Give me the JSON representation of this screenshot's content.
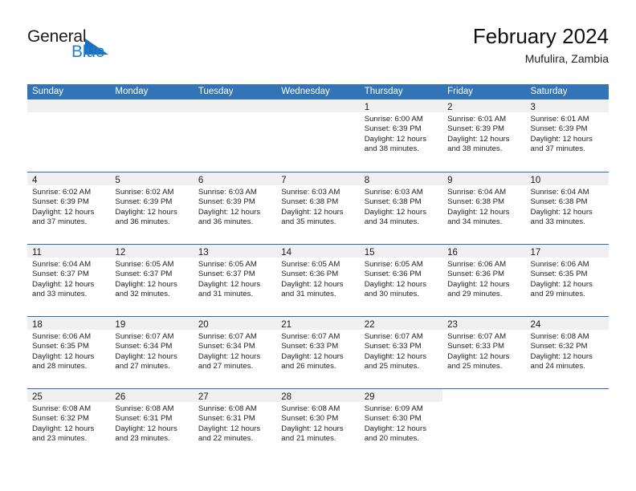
{
  "brand": {
    "word_general": "General",
    "word_blue": "Blue",
    "flag_icon": "triangle-flag-icon",
    "accent_color": "#1f7fd0"
  },
  "header": {
    "title": "February 2024",
    "subtitle": "Mufulira, Zambia"
  },
  "theme": {
    "header_blue": "#3274b5",
    "row_divider": "#2a6cb0",
    "daynum_band": "#f0f0f0"
  },
  "calendar": {
    "weekdays": [
      "Sunday",
      "Monday",
      "Tuesday",
      "Wednesday",
      "Thursday",
      "Friday",
      "Saturday"
    ],
    "weeks": [
      [
        {
          "day": "",
          "blank": true
        },
        {
          "day": "",
          "blank": true
        },
        {
          "day": "",
          "blank": true
        },
        {
          "day": "",
          "blank": true
        },
        {
          "day": "1",
          "sunrise": "Sunrise: 6:00 AM",
          "sunset": "Sunset: 6:39 PM",
          "daylight_line1": "Daylight: 12 hours",
          "daylight_line2": "and 38 minutes."
        },
        {
          "day": "2",
          "sunrise": "Sunrise: 6:01 AM",
          "sunset": "Sunset: 6:39 PM",
          "daylight_line1": "Daylight: 12 hours",
          "daylight_line2": "and 38 minutes."
        },
        {
          "day": "3",
          "sunrise": "Sunrise: 6:01 AM",
          "sunset": "Sunset: 6:39 PM",
          "daylight_line1": "Daylight: 12 hours",
          "daylight_line2": "and 37 minutes."
        }
      ],
      [
        {
          "day": "4",
          "sunrise": "Sunrise: 6:02 AM",
          "sunset": "Sunset: 6:39 PM",
          "daylight_line1": "Daylight: 12 hours",
          "daylight_line2": "and 37 minutes."
        },
        {
          "day": "5",
          "sunrise": "Sunrise: 6:02 AM",
          "sunset": "Sunset: 6:39 PM",
          "daylight_line1": "Daylight: 12 hours",
          "daylight_line2": "and 36 minutes."
        },
        {
          "day": "6",
          "sunrise": "Sunrise: 6:03 AM",
          "sunset": "Sunset: 6:39 PM",
          "daylight_line1": "Daylight: 12 hours",
          "daylight_line2": "and 36 minutes."
        },
        {
          "day": "7",
          "sunrise": "Sunrise: 6:03 AM",
          "sunset": "Sunset: 6:38 PM",
          "daylight_line1": "Daylight: 12 hours",
          "daylight_line2": "and 35 minutes."
        },
        {
          "day": "8",
          "sunrise": "Sunrise: 6:03 AM",
          "sunset": "Sunset: 6:38 PM",
          "daylight_line1": "Daylight: 12 hours",
          "daylight_line2": "and 34 minutes."
        },
        {
          "day": "9",
          "sunrise": "Sunrise: 6:04 AM",
          "sunset": "Sunset: 6:38 PM",
          "daylight_line1": "Daylight: 12 hours",
          "daylight_line2": "and 34 minutes."
        },
        {
          "day": "10",
          "sunrise": "Sunrise: 6:04 AM",
          "sunset": "Sunset: 6:38 PM",
          "daylight_line1": "Daylight: 12 hours",
          "daylight_line2": "and 33 minutes."
        }
      ],
      [
        {
          "day": "11",
          "sunrise": "Sunrise: 6:04 AM",
          "sunset": "Sunset: 6:37 PM",
          "daylight_line1": "Daylight: 12 hours",
          "daylight_line2": "and 33 minutes."
        },
        {
          "day": "12",
          "sunrise": "Sunrise: 6:05 AM",
          "sunset": "Sunset: 6:37 PM",
          "daylight_line1": "Daylight: 12 hours",
          "daylight_line2": "and 32 minutes."
        },
        {
          "day": "13",
          "sunrise": "Sunrise: 6:05 AM",
          "sunset": "Sunset: 6:37 PM",
          "daylight_line1": "Daylight: 12 hours",
          "daylight_line2": "and 31 minutes."
        },
        {
          "day": "14",
          "sunrise": "Sunrise: 6:05 AM",
          "sunset": "Sunset: 6:36 PM",
          "daylight_line1": "Daylight: 12 hours",
          "daylight_line2": "and 31 minutes."
        },
        {
          "day": "15",
          "sunrise": "Sunrise: 6:05 AM",
          "sunset": "Sunset: 6:36 PM",
          "daylight_line1": "Daylight: 12 hours",
          "daylight_line2": "and 30 minutes."
        },
        {
          "day": "16",
          "sunrise": "Sunrise: 6:06 AM",
          "sunset": "Sunset: 6:36 PM",
          "daylight_line1": "Daylight: 12 hours",
          "daylight_line2": "and 29 minutes."
        },
        {
          "day": "17",
          "sunrise": "Sunrise: 6:06 AM",
          "sunset": "Sunset: 6:35 PM",
          "daylight_line1": "Daylight: 12 hours",
          "daylight_line2": "and 29 minutes."
        }
      ],
      [
        {
          "day": "18",
          "sunrise": "Sunrise: 6:06 AM",
          "sunset": "Sunset: 6:35 PM",
          "daylight_line1": "Daylight: 12 hours",
          "daylight_line2": "and 28 minutes."
        },
        {
          "day": "19",
          "sunrise": "Sunrise: 6:07 AM",
          "sunset": "Sunset: 6:34 PM",
          "daylight_line1": "Daylight: 12 hours",
          "daylight_line2": "and 27 minutes."
        },
        {
          "day": "20",
          "sunrise": "Sunrise: 6:07 AM",
          "sunset": "Sunset: 6:34 PM",
          "daylight_line1": "Daylight: 12 hours",
          "daylight_line2": "and 27 minutes."
        },
        {
          "day": "21",
          "sunrise": "Sunrise: 6:07 AM",
          "sunset": "Sunset: 6:33 PM",
          "daylight_line1": "Daylight: 12 hours",
          "daylight_line2": "and 26 minutes."
        },
        {
          "day": "22",
          "sunrise": "Sunrise: 6:07 AM",
          "sunset": "Sunset: 6:33 PM",
          "daylight_line1": "Daylight: 12 hours",
          "daylight_line2": "and 25 minutes."
        },
        {
          "day": "23",
          "sunrise": "Sunrise: 6:07 AM",
          "sunset": "Sunset: 6:33 PM",
          "daylight_line1": "Daylight: 12 hours",
          "daylight_line2": "and 25 minutes."
        },
        {
          "day": "24",
          "sunrise": "Sunrise: 6:08 AM",
          "sunset": "Sunset: 6:32 PM",
          "daylight_line1": "Daylight: 12 hours",
          "daylight_line2": "and 24 minutes."
        }
      ],
      [
        {
          "day": "25",
          "sunrise": "Sunrise: 6:08 AM",
          "sunset": "Sunset: 6:32 PM",
          "daylight_line1": "Daylight: 12 hours",
          "daylight_line2": "and 23 minutes."
        },
        {
          "day": "26",
          "sunrise": "Sunrise: 6:08 AM",
          "sunset": "Sunset: 6:31 PM",
          "daylight_line1": "Daylight: 12 hours",
          "daylight_line2": "and 23 minutes."
        },
        {
          "day": "27",
          "sunrise": "Sunrise: 6:08 AM",
          "sunset": "Sunset: 6:31 PM",
          "daylight_line1": "Daylight: 12 hours",
          "daylight_line2": "and 22 minutes."
        },
        {
          "day": "28",
          "sunrise": "Sunrise: 6:08 AM",
          "sunset": "Sunset: 6:30 PM",
          "daylight_line1": "Daylight: 12 hours",
          "daylight_line2": "and 21 minutes."
        },
        {
          "day": "29",
          "sunrise": "Sunrise: 6:09 AM",
          "sunset": "Sunset: 6:30 PM",
          "daylight_line1": "Daylight: 12 hours",
          "daylight_line2": "and 20 minutes."
        },
        {
          "day": "",
          "empty": true
        },
        {
          "day": "",
          "empty": true
        }
      ]
    ]
  }
}
